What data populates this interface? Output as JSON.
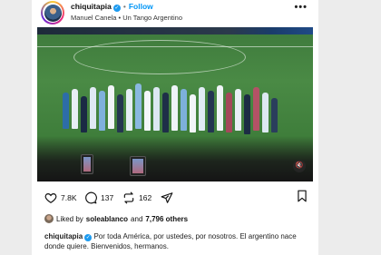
{
  "header": {
    "username": "chiquitapia",
    "follow_label": "Follow",
    "separator": "•",
    "audio": "Manuel Canela • Un Tango Argentino",
    "more_label": "•••"
  },
  "video": {
    "mute_icon": "speaker-muted-icon"
  },
  "actions": {
    "like_count": "7.8K",
    "comment_count": "137",
    "repost_count": "162"
  },
  "likes": {
    "prefix": "Liked by",
    "first_user": "soleablanco",
    "and_label": "and",
    "others": "7,796 others"
  },
  "caption": {
    "username": "chiquitapia",
    "text": "Por toda América, por ustedes, por nosotros. El argentino nace donde quiere. Bienvenidos, hermanos."
  },
  "colors": {
    "accent": "#0095f6",
    "verified": "#1d9bf0",
    "pitch": "#4a8a45"
  }
}
